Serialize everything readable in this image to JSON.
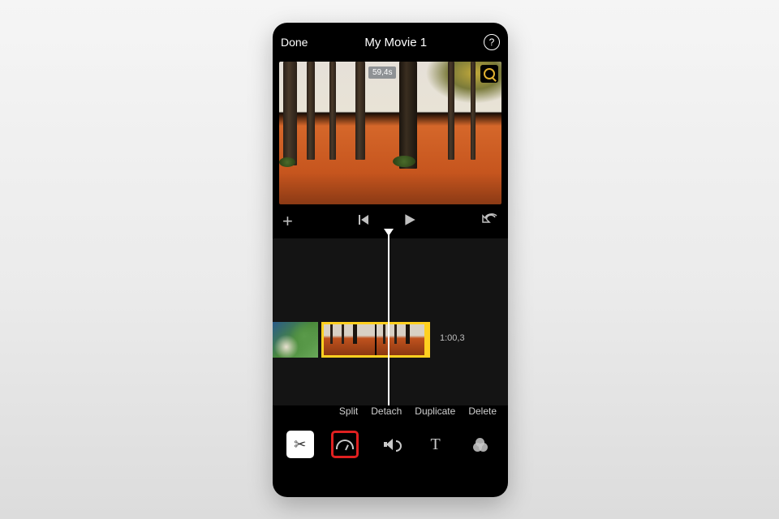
{
  "header": {
    "done_label": "Done",
    "title": "My Movie 1",
    "help_label": "?"
  },
  "viewer": {
    "duration_badge": "59,4s"
  },
  "transport": {
    "add_label": "+"
  },
  "timeline": {
    "clip_duration": "1:00,3"
  },
  "actions": {
    "split": "Split",
    "detach": "Detach",
    "duplicate": "Duplicate",
    "delete": "Delete"
  },
  "toolbar": {
    "text_label": "T"
  }
}
